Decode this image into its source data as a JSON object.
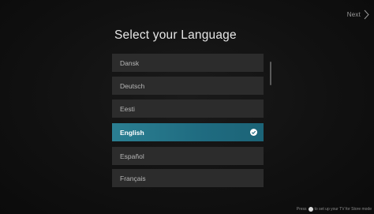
{
  "header": {
    "next_label": "Next",
    "title": "Select your Language"
  },
  "languages": [
    {
      "label": "Dansk",
      "selected": false
    },
    {
      "label": "Deutsch",
      "selected": false
    },
    {
      "label": "Eesti",
      "selected": false
    },
    {
      "label": "English",
      "selected": true
    },
    {
      "label": "Español",
      "selected": false
    },
    {
      "label": "Français",
      "selected": false
    }
  ],
  "footer": {
    "hint_prefix": "Press",
    "hint_suffix": "to set up your TV for Store mode"
  },
  "colors": {
    "accent": "#2b7f92",
    "item_background": "#2c2c2c",
    "screen_background": "#111111"
  }
}
